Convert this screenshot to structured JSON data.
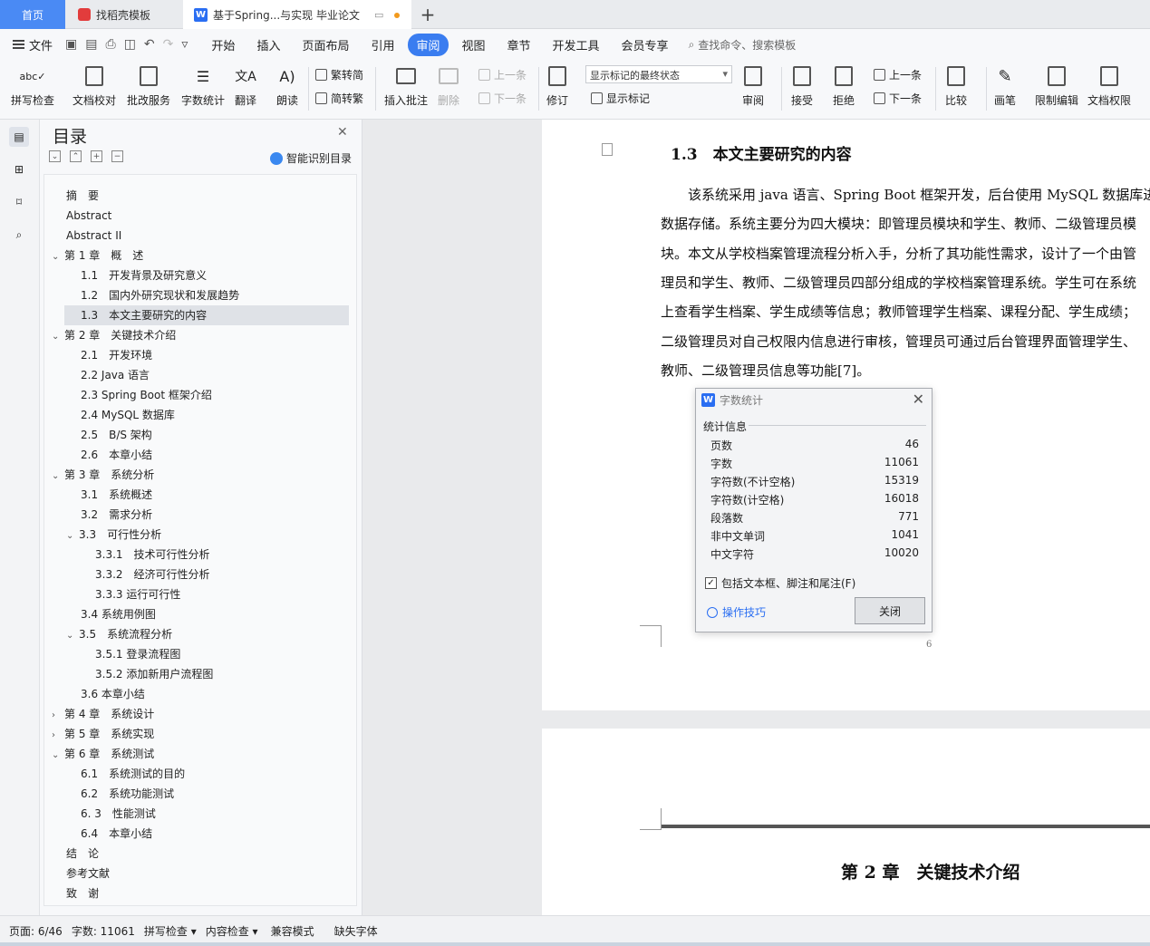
{
  "tabs": {
    "home": "首页",
    "template": "找稻壳模板",
    "doc": "基于Spring...与实现 毕业论文"
  },
  "menu": {
    "file": "文件",
    "items": [
      "开始",
      "插入",
      "页面布局",
      "引用",
      "审阅",
      "视图",
      "章节",
      "开发工具",
      "会员专享"
    ],
    "active": "审阅",
    "search": "查找命令、搜索模板"
  },
  "ribbon": {
    "spell": "拼写检查",
    "proof": "文档校对",
    "batch": "批改服务",
    "wordcount": "字数统计",
    "translate": "翻译",
    "read": "朗读",
    "trad": "繁转简",
    "simp": "简转繁",
    "insert_comment": "插入批注",
    "delete": "删除",
    "prev": "上一条",
    "next": "下一条",
    "revise": "修订",
    "markup_select": "显示标记的最终状态",
    "show_markup": "显示标记",
    "review": "审阅",
    "accept": "接受",
    "reject": "拒绝",
    "prev2": "上一条",
    "next2": "下一条",
    "compare": "比较",
    "pen": "画笔",
    "restrict": "限制编辑",
    "rights": "文档权限"
  },
  "toc": {
    "title": "目录",
    "ai_label": "智能识别目录",
    "items": [
      {
        "text": "摘　要",
        "level": 0,
        "arrow": ""
      },
      {
        "text": "Abstract",
        "level": 0,
        "arrow": ""
      },
      {
        "text": "Abstract II",
        "level": 0,
        "arrow": ""
      },
      {
        "text": "第 1 章　概　述",
        "level": 0,
        "arrow": "v"
      },
      {
        "text": "1.1　开发背景及研究意义",
        "level": 1,
        "arrow": ""
      },
      {
        "text": "1.2　国内外研究现状和发展趋势",
        "level": 1,
        "arrow": ""
      },
      {
        "text": "1.3　本文主要研究的内容",
        "level": 1,
        "arrow": "",
        "selected": true
      },
      {
        "text": "第 2 章　关键技术介绍",
        "level": 0,
        "arrow": "v"
      },
      {
        "text": "2.1　开发环境",
        "level": 1,
        "arrow": ""
      },
      {
        "text": "2.2 Java 语言",
        "level": 1,
        "arrow": ""
      },
      {
        "text": "2.3 Spring Boot 框架介绍",
        "level": 1,
        "arrow": ""
      },
      {
        "text": "2.4 MySQL 数据库",
        "level": 1,
        "arrow": ""
      },
      {
        "text": "2.5　B/S 架构",
        "level": 1,
        "arrow": ""
      },
      {
        "text": "2.6　本章小结",
        "level": 1,
        "arrow": ""
      },
      {
        "text": "第 3 章　系统分析",
        "level": 0,
        "arrow": "v"
      },
      {
        "text": "3.1　系统概述",
        "level": 1,
        "arrow": ""
      },
      {
        "text": "3.2　需求分析",
        "level": 1,
        "arrow": ""
      },
      {
        "text": "3.3　可行性分析",
        "level": 1,
        "arrow": "v"
      },
      {
        "text": "3.3.1　技术可行性分析",
        "level": 2,
        "arrow": ""
      },
      {
        "text": "3.3.2　经济可行性分析",
        "level": 2,
        "arrow": ""
      },
      {
        "text": "3.3.3 运行可行性",
        "level": 2,
        "arrow": ""
      },
      {
        "text": "3.4 系统用例图",
        "level": 1,
        "arrow": ""
      },
      {
        "text": "3.5　系统流程分析",
        "level": 1,
        "arrow": "v"
      },
      {
        "text": "3.5.1 登录流程图",
        "level": 2,
        "arrow": ""
      },
      {
        "text": "3.5.2 添加新用户流程图",
        "level": 2,
        "arrow": ""
      },
      {
        "text": "3.6 本章小结",
        "level": 1,
        "arrow": ""
      },
      {
        "text": "第 4 章　系统设计",
        "level": 0,
        "arrow": ">"
      },
      {
        "text": "第 5 章　系统实现",
        "level": 0,
        "arrow": ">"
      },
      {
        "text": "第 6 章　系统测试",
        "level": 0,
        "arrow": "v"
      },
      {
        "text": "6.1　系统测试的目的",
        "level": 1,
        "arrow": ""
      },
      {
        "text": "6.2　系统功能测试",
        "level": 1,
        "arrow": ""
      },
      {
        "text": "6. 3　性能测试",
        "level": 1,
        "arrow": ""
      },
      {
        "text": "6.4　本章小结",
        "level": 1,
        "arrow": ""
      },
      {
        "text": "结　论",
        "level": 0,
        "arrow": ""
      },
      {
        "text": "参考文献",
        "level": 0,
        "arrow": ""
      },
      {
        "text": "致　谢",
        "level": 0,
        "arrow": ""
      }
    ]
  },
  "document": {
    "heading": "1.3　本文主要研究的内容",
    "lines": [
      "　　该系统采用 java 语言、Spring Boot 框架开发，后台使用 MySQL 数据库进行",
      "数据存储。系统主要分为四大模块：即管理员模块和学生、教师、二级管理员模",
      "块。本文从学校档案管理流程分析入手，分析了其功能性需求，设计了一个由管",
      "理员和学生、教师、二级管理员四部分组成的学校档案管理系统。学生可在系统",
      "上查看学生档案、学生成绩等信息；教师管理学生档案、课程分配、学生成绩；",
      "二级管理员对自己权限内信息进行审核，管理员可通过后台管理界面管理学生、",
      "教师、二级管理员信息等功能[7]。"
    ],
    "page_number": "6",
    "chapter2": "第 2 章　关键技术介绍"
  },
  "dialog": {
    "title": "字数统计",
    "group": "统计信息",
    "stats": [
      {
        "label": "页数",
        "value": "46"
      },
      {
        "label": "字数",
        "value": "11061"
      },
      {
        "label": "字符数(不计空格)",
        "value": "15319"
      },
      {
        "label": "字符数(计空格)",
        "value": "16018"
      },
      {
        "label": "段落数",
        "value": "771"
      },
      {
        "label": "非中文单词",
        "value": "1041"
      },
      {
        "label": "中文字符",
        "value": "10020"
      }
    ],
    "checkbox": "包括文本框、脚注和尾注(F)",
    "tips": "操作技巧",
    "close": "关闭"
  },
  "status": {
    "page": "页面: 6/46",
    "words": "字数: 11061",
    "spell": "拼写检查",
    "content": "内容检查",
    "compat": "兼容模式",
    "missing_font": "缺失字体"
  },
  "colors": {
    "accent": "#3a7df0",
    "home_tab": "#4a8af4"
  }
}
